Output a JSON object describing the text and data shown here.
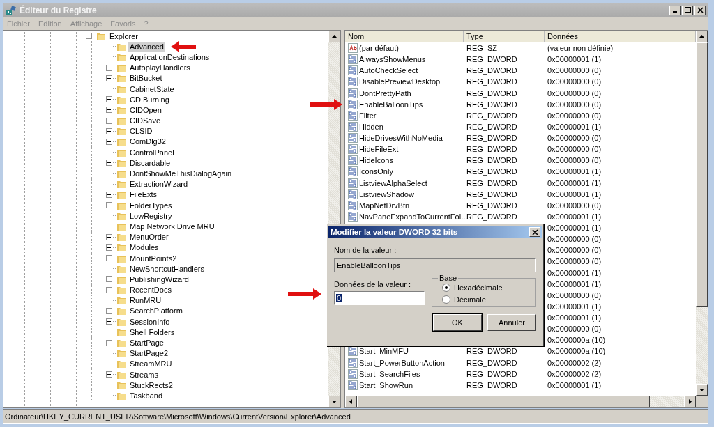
{
  "window": {
    "title": "Éditeur du Registre",
    "active": false
  },
  "menu": [
    "Fichier",
    "Edition",
    "Affichage",
    "Favoris",
    "?"
  ],
  "tree": {
    "label": "Explorer",
    "expanded": true,
    "children": [
      {
        "label": "Advanced",
        "expandable": false,
        "selected": true
      },
      {
        "label": "ApplicationDestinations",
        "expandable": false,
        "selected": false
      },
      {
        "label": "AutoplayHandlers",
        "expandable": true,
        "selected": false
      },
      {
        "label": "BitBucket",
        "expandable": true,
        "selected": false
      },
      {
        "label": "CabinetState",
        "expandable": false,
        "selected": false
      },
      {
        "label": "CD Burning",
        "expandable": true,
        "selected": false
      },
      {
        "label": "CIDOpen",
        "expandable": true,
        "selected": false
      },
      {
        "label": "CIDSave",
        "expandable": true,
        "selected": false
      },
      {
        "label": "CLSID",
        "expandable": true,
        "selected": false
      },
      {
        "label": "ComDlg32",
        "expandable": true,
        "selected": false
      },
      {
        "label": "ControlPanel",
        "expandable": false,
        "selected": false
      },
      {
        "label": "Discardable",
        "expandable": true,
        "selected": false
      },
      {
        "label": "DontShowMeThisDialogAgain",
        "expandable": false,
        "selected": false
      },
      {
        "label": "ExtractionWizard",
        "expandable": false,
        "selected": false
      },
      {
        "label": "FileExts",
        "expandable": true,
        "selected": false
      },
      {
        "label": "FolderTypes",
        "expandable": true,
        "selected": false
      },
      {
        "label": "LowRegistry",
        "expandable": false,
        "selected": false
      },
      {
        "label": "Map Network Drive MRU",
        "expandable": false,
        "selected": false
      },
      {
        "label": "MenuOrder",
        "expandable": true,
        "selected": false
      },
      {
        "label": "Modules",
        "expandable": true,
        "selected": false
      },
      {
        "label": "MountPoints2",
        "expandable": true,
        "selected": false
      },
      {
        "label": "NewShortcutHandlers",
        "expandable": false,
        "selected": false
      },
      {
        "label": "PublishingWizard",
        "expandable": true,
        "selected": false
      },
      {
        "label": "RecentDocs",
        "expandable": true,
        "selected": false
      },
      {
        "label": "RunMRU",
        "expandable": false,
        "selected": false
      },
      {
        "label": "SearchPlatform",
        "expandable": true,
        "selected": false
      },
      {
        "label": "SessionInfo",
        "expandable": true,
        "selected": false
      },
      {
        "label": "Shell Folders",
        "expandable": false,
        "selected": false
      },
      {
        "label": "StartPage",
        "expandable": true,
        "selected": false
      },
      {
        "label": "StartPage2",
        "expandable": false,
        "selected": false
      },
      {
        "label": "StreamMRU",
        "expandable": false,
        "selected": false
      },
      {
        "label": "Streams",
        "expandable": true,
        "selected": false
      },
      {
        "label": "StuckRects2",
        "expandable": false,
        "selected": false
      },
      {
        "label": "Taskband",
        "expandable": false,
        "selected": false
      }
    ]
  },
  "values": {
    "columns": [
      "Nom",
      "Type",
      "Données"
    ],
    "rows": [
      {
        "kind": "string",
        "name": "(par défaut)",
        "type": "REG_SZ",
        "data": "(valeur non définie)"
      },
      {
        "kind": "dword",
        "name": "AlwaysShowMenus",
        "type": "REG_DWORD",
        "data": "0x00000001 (1)"
      },
      {
        "kind": "dword",
        "name": "AutoCheckSelect",
        "type": "REG_DWORD",
        "data": "0x00000000 (0)"
      },
      {
        "kind": "dword",
        "name": "DisablePreviewDesktop",
        "type": "REG_DWORD",
        "data": "0x00000000 (0)"
      },
      {
        "kind": "dword",
        "name": "DontPrettyPath",
        "type": "REG_DWORD",
        "data": "0x00000000 (0)"
      },
      {
        "kind": "dword",
        "name": "EnableBalloonTips",
        "type": "REG_DWORD",
        "data": "0x00000000 (0)"
      },
      {
        "kind": "dword",
        "name": "Filter",
        "type": "REG_DWORD",
        "data": "0x00000000 (0)"
      },
      {
        "kind": "dword",
        "name": "Hidden",
        "type": "REG_DWORD",
        "data": "0x00000001 (1)"
      },
      {
        "kind": "dword",
        "name": "HideDrivesWithNoMedia",
        "type": "REG_DWORD",
        "data": "0x00000000 (0)"
      },
      {
        "kind": "dword",
        "name": "HideFileExt",
        "type": "REG_DWORD",
        "data": "0x00000000 (0)"
      },
      {
        "kind": "dword",
        "name": "HideIcons",
        "type": "REG_DWORD",
        "data": "0x00000000 (0)"
      },
      {
        "kind": "dword",
        "name": "IconsOnly",
        "type": "REG_DWORD",
        "data": "0x00000001 (1)"
      },
      {
        "kind": "dword",
        "name": "ListviewAlphaSelect",
        "type": "REG_DWORD",
        "data": "0x00000001 (1)"
      },
      {
        "kind": "dword",
        "name": "ListviewShadow",
        "type": "REG_DWORD",
        "data": "0x00000001 (1)"
      },
      {
        "kind": "dword",
        "name": "MapNetDrvBtn",
        "type": "REG_DWORD",
        "data": "0x00000000 (0)"
      },
      {
        "kind": "dword",
        "name": "NavPaneExpandToCurrentFol...",
        "type": "REG_DWORD",
        "data": "0x00000001 (1)"
      },
      {
        "kind": "covered",
        "data": "0x00000001 (1)"
      },
      {
        "kind": "covered",
        "data": "0x00000000 (0)"
      },
      {
        "kind": "covered",
        "data": "0x00000000 (0)"
      },
      {
        "kind": "covered",
        "data": "0x00000000 (0)"
      },
      {
        "kind": "covered",
        "data": "0x00000001 (1)"
      },
      {
        "kind": "covered",
        "data": "0x00000001 (1)"
      },
      {
        "kind": "covered",
        "data": "0x00000000 (0)"
      },
      {
        "kind": "covered",
        "data": "0x00000001 (1)"
      },
      {
        "kind": "covered",
        "data": "0x00000001 (1)"
      },
      {
        "kind": "covered",
        "data": "0x00000000 (0)"
      },
      {
        "kind": "covered",
        "data": "0x0000000a (10)"
      },
      {
        "kind": "dword",
        "name": "Start_MinMFU",
        "type": "REG_DWORD",
        "data": "0x0000000a (10)"
      },
      {
        "kind": "dword",
        "name": "Start_PowerButtonAction",
        "type": "REG_DWORD",
        "data": "0x00000002 (2)"
      },
      {
        "kind": "dword",
        "name": "Start_SearchFiles",
        "type": "REG_DWORD",
        "data": "0x00000002 (2)"
      },
      {
        "kind": "dword",
        "name": "Start_ShowRun",
        "type": "REG_DWORD",
        "data": "0x00000001 (1)"
      }
    ]
  },
  "dialog": {
    "title": "Modifier la valeur DWORD 32 bits",
    "name_label": "Nom de la valeur :",
    "name_value": "EnableBalloonTips",
    "data_label": "Données de la valeur :",
    "data_value": "0",
    "base_label": "Base",
    "bases": [
      {
        "label": "Hexadécimale",
        "selected": true
      },
      {
        "label": "Décimale",
        "selected": false
      }
    ],
    "buttons": [
      {
        "label": "OK",
        "default": true
      },
      {
        "label": "Annuler",
        "default": false
      }
    ]
  },
  "status_bar": "Ordinateur\\HKEY_CURRENT_USER\\Software\\Microsoft\\Windows\\CurrentVersion\\Explorer\\Advanced"
}
